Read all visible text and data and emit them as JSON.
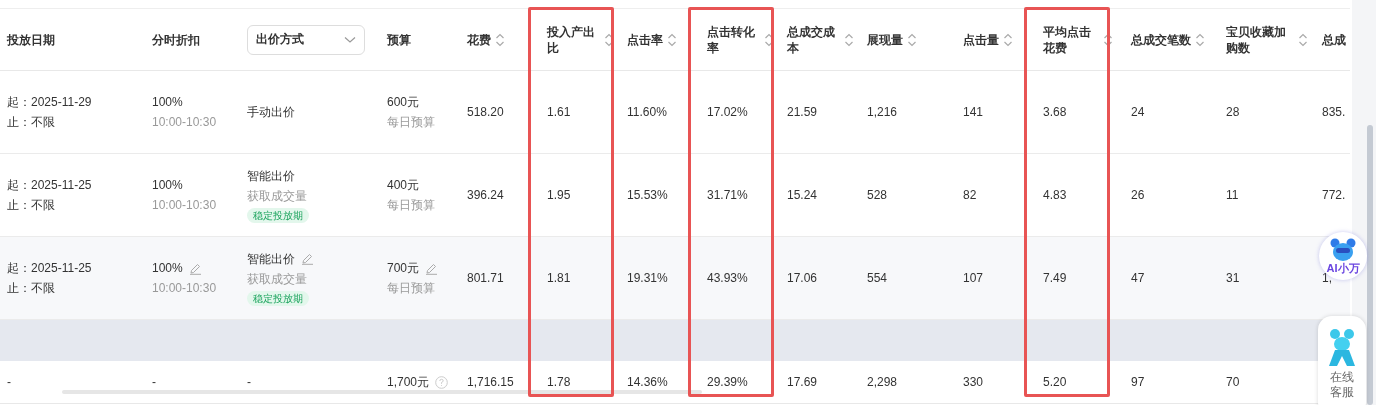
{
  "columns": [
    {
      "label": "投放日期",
      "kind": "text",
      "sortable": false,
      "highlighted": false
    },
    {
      "label": "分时折扣",
      "kind": "text",
      "sortable": false,
      "highlighted": false
    },
    {
      "label": "出价方式",
      "kind": "dropdown",
      "sortable": false,
      "highlighted": false
    },
    {
      "label": "预算",
      "kind": "text",
      "sortable": false,
      "highlighted": false
    },
    {
      "label": "花费",
      "kind": "text",
      "sortable": true,
      "highlighted": false
    },
    {
      "label": "投入产出比",
      "kind": "text",
      "sortable": true,
      "highlighted": true
    },
    {
      "label": "点击率",
      "kind": "text",
      "sortable": true,
      "highlighted": false
    },
    {
      "label": "点击转化率",
      "kind": "text",
      "sortable": true,
      "highlighted": true
    },
    {
      "label": "总成交成本",
      "kind": "text",
      "sortable": true,
      "highlighted": false
    },
    {
      "label": "展现量",
      "kind": "text",
      "sortable": true,
      "highlighted": false
    },
    {
      "label": "点击量",
      "kind": "text",
      "sortable": true,
      "highlighted": false
    },
    {
      "label": "平均点击花费",
      "kind": "text",
      "sortable": true,
      "highlighted": true
    },
    {
      "label": "总成交笔数",
      "kind": "text",
      "sortable": true,
      "highlighted": false
    },
    {
      "label": "宝贝收藏加购数",
      "kind": "text",
      "sortable": true,
      "highlighted": false
    },
    {
      "label": "总成",
      "kind": "text",
      "highlighted": false
    }
  ],
  "rows": [
    {
      "start": "起：2025-11-29",
      "end": "止：不限",
      "discount": "100%",
      "time": "10:00-10:30",
      "bid_method": "手动出价",
      "budget": "600元",
      "budget_note": "每日预算",
      "editable": false,
      "hovered": false,
      "metrics": [
        "518.20",
        "1.61",
        "11.60%",
        "17.02%",
        "21.59",
        "1,216",
        "141",
        "3.68",
        "24",
        "28",
        "835."
      ]
    },
    {
      "start": "起：2025-11-25",
      "end": "止：不限",
      "discount": "100%",
      "time": "10:00-10:30",
      "bid_method": "智能出价",
      "bid_goal": "获取成交量",
      "bid_tag": "稳定投放期",
      "budget": "400元",
      "budget_note": "每日预算",
      "editable": false,
      "hovered": false,
      "metrics": [
        "396.24",
        "1.95",
        "15.53%",
        "31.71%",
        "15.24",
        "528",
        "82",
        "4.83",
        "26",
        "11",
        "772."
      ]
    },
    {
      "start": "起：2025-11-25",
      "end": "止：不限",
      "discount": "100%",
      "time": "10:00-10:30",
      "bid_method": "智能出价",
      "bid_goal": "获取成交量",
      "bid_tag": "稳定投放期",
      "budget": "700元",
      "budget_note": "每日预算",
      "editable": true,
      "hovered": true,
      "metrics": [
        "801.71",
        "1.81",
        "19.31%",
        "43.93%",
        "17.06",
        "554",
        "107",
        "7.49",
        "47",
        "31",
        "1,"
      ]
    }
  ],
  "total": {
    "date": "-",
    "discount": "-",
    "bid": "-",
    "budget": "1,700元",
    "metrics": [
      "1,716.15",
      "1.78",
      "14.36%",
      "29.39%",
      "17.69",
      "2,298",
      "330",
      "5.20",
      "97",
      "70"
    ]
  },
  "assistant": {
    "label": "AI小万"
  },
  "service": {
    "label": "在线客服"
  }
}
